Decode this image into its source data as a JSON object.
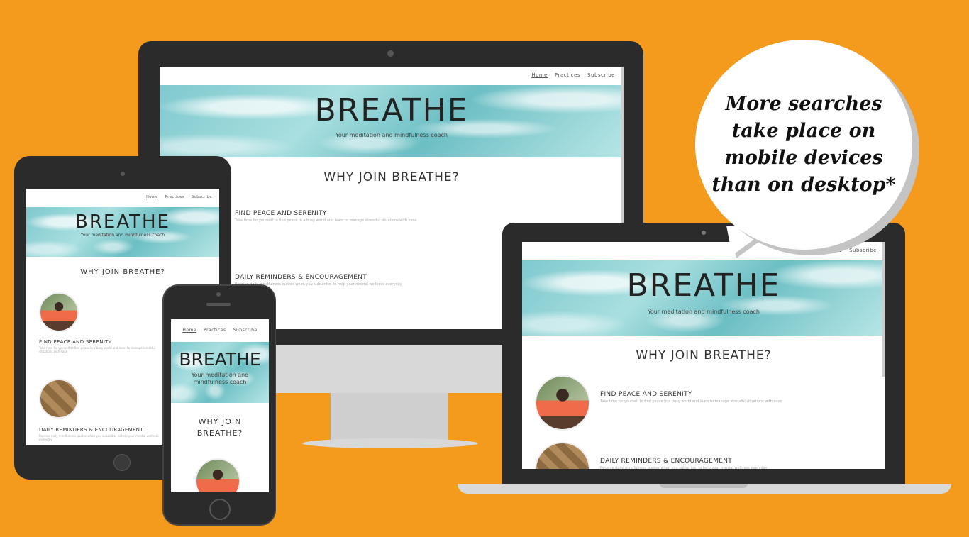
{
  "site": {
    "nav": [
      "Home",
      "Practices",
      "Subscribe"
    ],
    "brand": "BREATHE",
    "tagline": "Your meditation and mindfulness coach",
    "why": "WHY JOIN BREATHE?",
    "why_line1": "WHY JOIN",
    "why_line2": "BREATHE?",
    "feature1_title": "FIND PEACE AND SERENITY",
    "feature1_desc": "Take time for yourself to find peace in a busy world and learn to manage stressful situations with ease",
    "feature2_title": "DAILY REMINDERS & ENCOURAGEMENT",
    "feature2_desc": "Receive daily mindfulness quotes when you subscribe, to help your mental wellness everyday"
  },
  "laptop": {
    "nav_partial": "ces"
  },
  "bubble": {
    "text": "More searches take place on mobile devices than on desktop*"
  },
  "colors": {
    "background": "#f49a1c",
    "bezel": "#2b2b2b",
    "hero": "#8fd1d3"
  }
}
